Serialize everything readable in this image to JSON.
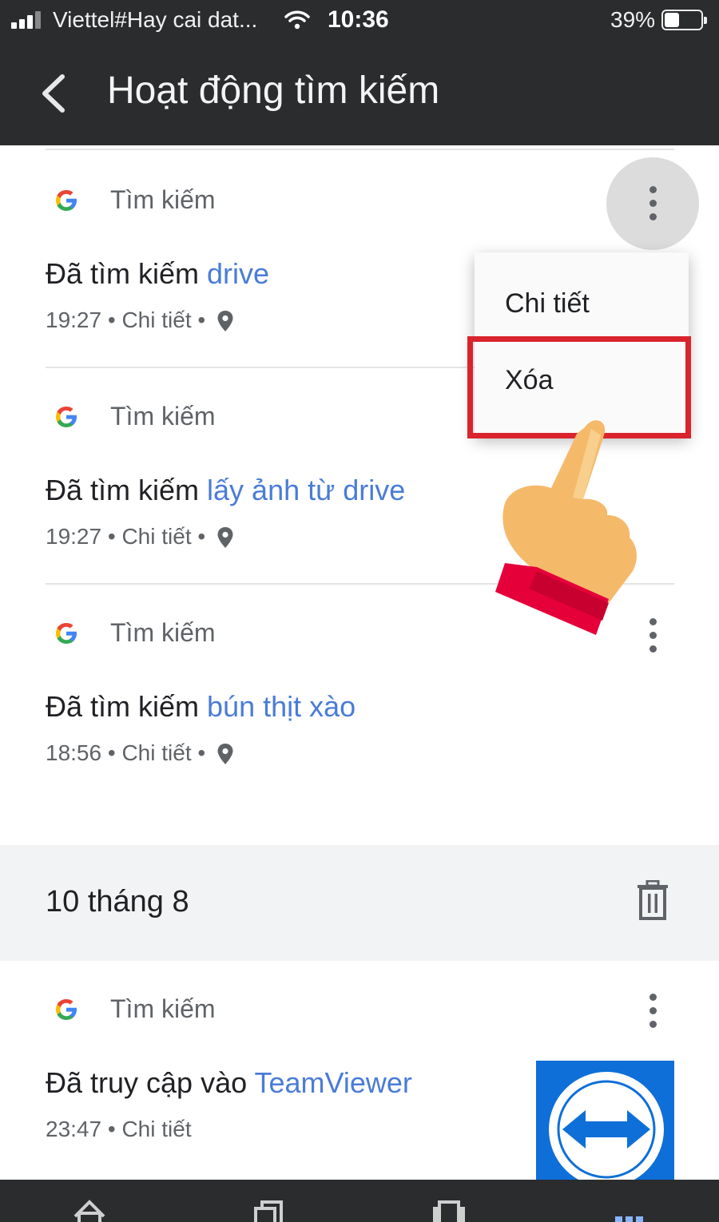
{
  "status_bar": {
    "carrier": "Viettel#Hay cai dat...",
    "time": "10:36",
    "battery_percent": "39%",
    "battery_level": 0.39
  },
  "app_bar": {
    "title": "Hoạt động tìm kiếm",
    "back_icon": "arrow-left-icon"
  },
  "items": [
    {
      "source": "Tìm kiếm",
      "prefix": "Đã tìm kiếm ",
      "query": "drive",
      "time": "19:27",
      "sep": " • ",
      "detail": "Chi tiết",
      "sep2": " • ",
      "has_location": true
    },
    {
      "source": "Tìm kiếm",
      "prefix": "Đã tìm kiếm ",
      "query": "lấy ảnh từ drive",
      "time": "19:27",
      "sep": " • ",
      "detail": "Chi tiết",
      "sep2": " • ",
      "has_location": true
    },
    {
      "source": "Tìm kiếm",
      "prefix": "Đã tìm kiếm ",
      "query": "bún thịt xào",
      "time": "18:56",
      "sep": " • ",
      "detail": "Chi tiết",
      "sep2": " • ",
      "has_location": true
    }
  ],
  "popup_menu": {
    "items": [
      "Chi tiết",
      "Xóa"
    ],
    "highlighted": "Xóa"
  },
  "day_group": {
    "label": "10 tháng 8",
    "action_icon": "trash-icon"
  },
  "visited_item": {
    "source": "Tìm kiếm",
    "prefix": "Đã truy cập vào ",
    "site": "TeamViewer",
    "time": "23:47",
    "sep": " • ",
    "detail": "Chi tiết",
    "thumbnail_icon": "teamviewer-logo"
  },
  "bottom_nav": {
    "icons": [
      "home-icon",
      "tabs-icon",
      "pages-icon",
      "more-icon"
    ]
  },
  "colors": {
    "app_bar": "#2b2c2e",
    "link": "#4a7cd6",
    "highlight": "#d9232d",
    "day_band": "#f1f3f4"
  }
}
